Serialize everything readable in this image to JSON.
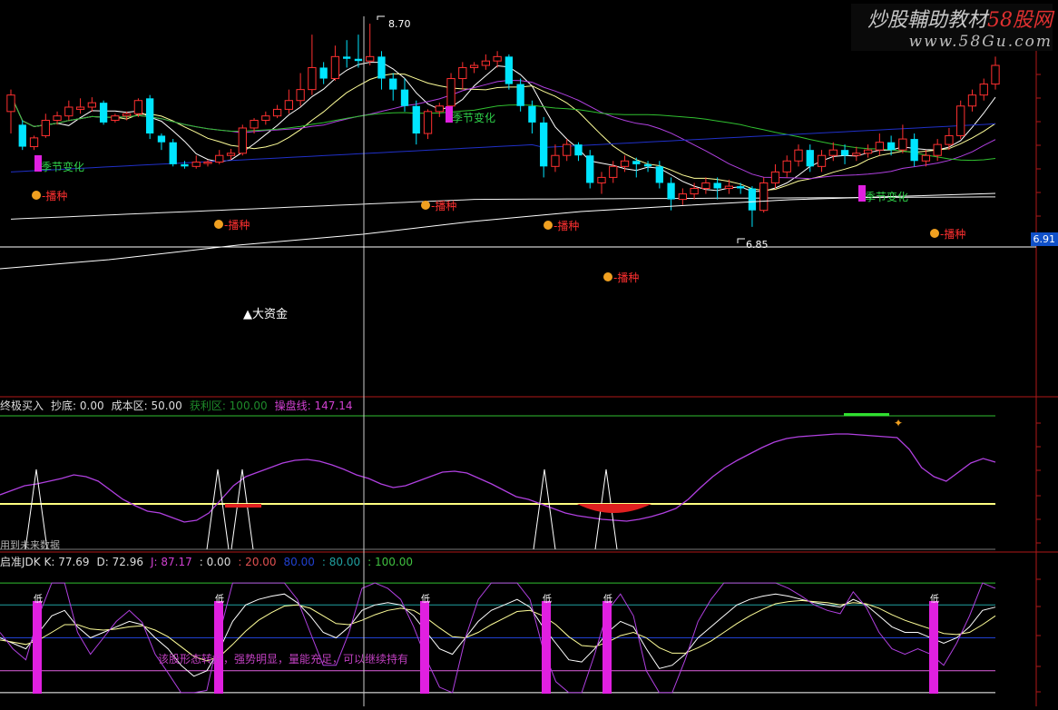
{
  "watermark": {
    "line1_a": "炒股輔助教材",
    "line1_b": "58股网",
    "line2": "www.58Gu.com"
  },
  "price_axis": {
    "current": "6.91"
  },
  "main_panel": {
    "high_label": "8.70",
    "low_label": "6.85",
    "big_fund_label": "▲大资金",
    "annotations": [
      {
        "text": "季节变化",
        "type": "season"
      },
      {
        "text": "季节变化",
        "type": "season"
      },
      {
        "text": "季节变化",
        "type": "season"
      },
      {
        "text": "播种",
        "type": "sow"
      },
      {
        "text": "播种",
        "type": "sow"
      },
      {
        "text": "播种",
        "type": "sow"
      },
      {
        "text": "播种",
        "type": "sow"
      },
      {
        "text": "播种",
        "type": "sow"
      },
      {
        "text": "播种",
        "type": "sow"
      }
    ]
  },
  "mid_panel": {
    "items": [
      {
        "label": "终极买入",
        "color": "#dddddd"
      },
      {
        "label": "抄底: 0.00",
        "color": "#dddddd"
      },
      {
        "label": "成本区: 50.00",
        "color": "#dddddd"
      },
      {
        "label": "获利区: 100.00",
        "color": "#1e8a2a"
      },
      {
        "label": "操盘线: 147.14",
        "color": "#d040d0"
      }
    ],
    "footer_text": "用到未来数据"
  },
  "lower_panel": {
    "items": [
      {
        "label": "启准JDK K: 77.69",
        "color": "#dddddd"
      },
      {
        "label": "D: 72.96",
        "color": "#dddddd"
      },
      {
        "label": "J: 87.17",
        "color": "#d040d0"
      },
      {
        "label": ": 0.00",
        "color": "#dddddd"
      },
      {
        "label": ": 20.00",
        "color": "#e05050"
      },
      {
        "label": "80.00",
        "color": "#2040d0"
      },
      {
        "label": ": 80.00",
        "color": "#20a0a0"
      },
      {
        "label": ": 100.00",
        "color": "#40c040"
      }
    ],
    "comment": "该股形态转好，强势明显，量能充足，可以继续持有",
    "low_marker": "低"
  },
  "colors": {
    "up": "#ff3030",
    "down": "#00e5ff",
    "magenta": "#e020e0",
    "purple": "#b040e0",
    "green": "#30c030",
    "blue": "#2030c8",
    "white": "#ffffff",
    "yellow": "#ffff80"
  },
  "chart_data": [
    {
      "type": "candlestick",
      "title": "",
      "ylim": [
        6.7,
        8.75
      ],
      "candles": [
        [
          0,
          7.9,
          8.05,
          7.7,
          8.1
        ],
        [
          1,
          7.78,
          7.58,
          7.55,
          7.82
        ],
        [
          2,
          7.58,
          7.66,
          7.55,
          7.68
        ],
        [
          3,
          7.68,
          7.82,
          7.66,
          7.88
        ],
        [
          4,
          7.82,
          7.86,
          7.78,
          7.9
        ],
        [
          5,
          7.86,
          7.94,
          7.82,
          8.0
        ],
        [
          6,
          7.92,
          7.94,
          7.88,
          8.02
        ],
        [
          7,
          7.94,
          7.98,
          7.9,
          8.03
        ],
        [
          8,
          7.98,
          7.8,
          7.78,
          8.0
        ],
        [
          9,
          7.82,
          7.86,
          7.8,
          7.88
        ],
        [
          10,
          7.86,
          7.88,
          7.82,
          7.9
        ],
        [
          11,
          7.88,
          8.0,
          7.85,
          8.02
        ],
        [
          12,
          8.02,
          7.7,
          7.65,
          8.05
        ],
        [
          13,
          7.68,
          7.62,
          7.55,
          7.7
        ],
        [
          14,
          7.62,
          7.42,
          7.4,
          7.65
        ],
        [
          15,
          7.42,
          7.4,
          7.38,
          7.45
        ],
        [
          16,
          7.4,
          7.44,
          7.38,
          7.5
        ],
        [
          17,
          7.44,
          7.44,
          7.4,
          7.46
        ],
        [
          18,
          7.44,
          7.5,
          7.42,
          7.55
        ],
        [
          19,
          7.5,
          7.52,
          7.46,
          7.56
        ],
        [
          20,
          7.52,
          7.75,
          7.5,
          7.78
        ],
        [
          21,
          7.75,
          7.82,
          7.7,
          7.84
        ],
        [
          22,
          7.82,
          7.86,
          7.78,
          7.9
        ],
        [
          23,
          7.86,
          7.92,
          7.84,
          7.96
        ],
        [
          24,
          7.92,
          8.0,
          7.88,
          8.1
        ],
        [
          25,
          8.0,
          8.1,
          7.95,
          8.25
        ],
        [
          26,
          8.1,
          8.3,
          8.05,
          8.6
        ],
        [
          27,
          8.3,
          8.2,
          8.15,
          8.35
        ],
        [
          28,
          8.2,
          8.4,
          8.18,
          8.5
        ],
        [
          29,
          8.4,
          8.38,
          8.3,
          8.55
        ],
        [
          30,
          8.38,
          8.36,
          8.3,
          8.6
        ],
        [
          31,
          8.36,
          8.4,
          8.32,
          8.7
        ],
        [
          32,
          8.4,
          8.2,
          8.1,
          8.45
        ],
        [
          33,
          8.2,
          8.1,
          8.0,
          8.25
        ],
        [
          34,
          8.1,
          7.95,
          7.9,
          8.2
        ],
        [
          35,
          7.95,
          7.7,
          7.6,
          8.0
        ],
        [
          36,
          7.7,
          7.9,
          7.65,
          7.92
        ],
        [
          37,
          7.9,
          7.95,
          7.85,
          7.98
        ],
        [
          38,
          7.95,
          8.2,
          7.9,
          8.25
        ],
        [
          39,
          8.2,
          8.3,
          8.1,
          8.35
        ],
        [
          40,
          8.3,
          8.32,
          8.25,
          8.35
        ],
        [
          41,
          8.32,
          8.36,
          8.28,
          8.42
        ],
        [
          42,
          8.36,
          8.4,
          8.3,
          8.45
        ],
        [
          43,
          8.4,
          8.15,
          8.1,
          8.42
        ],
        [
          44,
          8.15,
          7.95,
          7.9,
          8.2
        ],
        [
          45,
          7.95,
          7.8,
          7.7,
          8.0
        ],
        [
          46,
          7.8,
          7.4,
          7.3,
          7.85
        ],
        [
          47,
          7.4,
          7.5,
          7.35,
          7.6
        ],
        [
          48,
          7.5,
          7.6,
          7.45,
          7.65
        ],
        [
          49,
          7.6,
          7.5,
          7.45,
          7.62
        ],
        [
          50,
          7.5,
          7.25,
          7.2,
          7.55
        ],
        [
          51,
          7.25,
          7.3,
          7.15,
          7.35
        ],
        [
          52,
          7.3,
          7.4,
          7.25,
          7.45
        ],
        [
          53,
          7.4,
          7.45,
          7.35,
          7.5
        ],
        [
          54,
          7.45,
          7.42,
          7.3,
          7.48
        ],
        [
          55,
          7.42,
          7.4,
          7.35,
          7.45
        ],
        [
          56,
          7.4,
          7.25,
          7.2,
          7.45
        ],
        [
          57,
          7.25,
          7.1,
          7.0,
          7.3
        ],
        [
          58,
          7.1,
          7.15,
          7.05,
          7.2
        ],
        [
          59,
          7.15,
          7.2,
          7.1,
          7.25
        ],
        [
          60,
          7.2,
          7.25,
          7.15,
          7.3
        ],
        [
          61,
          7.25,
          7.2,
          7.1,
          7.3
        ],
        [
          62,
          7.2,
          7.22,
          7.15,
          7.28
        ],
        [
          63,
          7.22,
          7.2,
          7.15,
          7.25
        ],
        [
          64,
          7.2,
          7.0,
          6.85,
          7.22
        ],
        [
          65,
          7.0,
          7.25,
          6.98,
          7.3
        ],
        [
          66,
          7.25,
          7.35,
          7.2,
          7.42
        ],
        [
          67,
          7.35,
          7.45,
          7.3,
          7.5
        ],
        [
          68,
          7.45,
          7.55,
          7.4,
          7.6
        ],
        [
          69,
          7.55,
          7.4,
          7.35,
          7.6
        ],
        [
          70,
          7.4,
          7.5,
          7.35,
          7.55
        ],
        [
          71,
          7.5,
          7.55,
          7.45,
          7.62
        ],
        [
          72,
          7.55,
          7.5,
          7.42,
          7.6
        ],
        [
          73,
          7.5,
          7.52,
          7.45,
          7.58
        ],
        [
          74,
          7.52,
          7.55,
          7.48,
          7.6
        ],
        [
          75,
          7.55,
          7.62,
          7.5,
          7.7
        ],
        [
          76,
          7.62,
          7.55,
          7.5,
          7.68
        ],
        [
          77,
          7.55,
          7.65,
          7.52,
          7.78
        ],
        [
          78,
          7.65,
          7.45,
          7.4,
          7.7
        ],
        [
          79,
          7.45,
          7.5,
          7.4,
          7.55
        ],
        [
          80,
          7.5,
          7.6,
          7.45,
          7.65
        ],
        [
          81,
          7.6,
          7.68,
          7.55,
          7.75
        ],
        [
          82,
          7.68,
          7.95,
          7.65,
          8.0
        ],
        [
          83,
          7.95,
          8.05,
          7.9,
          8.1
        ],
        [
          84,
          8.05,
          8.15,
          8.0,
          8.2
        ],
        [
          85,
          8.15,
          8.32,
          8.1,
          8.4
        ]
      ]
    },
    {
      "type": "line",
      "title": "",
      "series": [
        {
          "values": [
            60,
            65,
            70,
            72,
            75,
            78,
            82,
            80,
            75,
            65,
            55,
            48,
            42,
            40,
            35,
            30,
            32,
            40,
            55,
            70,
            80,
            85,
            90,
            95,
            98,
            99,
            97,
            93,
            88,
            82,
            78,
            72,
            68,
            70,
            75,
            80,
            85,
            86,
            84,
            78,
            72,
            65,
            58,
            55,
            50,
            45,
            40,
            37,
            35,
            33,
            32,
            31,
            33,
            36,
            40,
            45,
            55,
            68,
            80,
            90,
            98,
            105,
            112,
            118,
            122,
            124,
            125,
            126,
            127,
            127,
            126,
            125,
            124,
            123,
            110,
            90,
            80,
            75,
            85,
            95,
            100,
            96
          ]
        }
      ],
      "ylim": [
        0,
        150
      ]
    },
    {
      "type": "line",
      "title": "",
      "series": [
        {
          "name": "K",
          "values": [
            50,
            45,
            40,
            55,
            70,
            75,
            60,
            50,
            55,
            60,
            65,
            62,
            50,
            40,
            25,
            15,
            20,
            40,
            65,
            80,
            85,
            88,
            90,
            82,
            70,
            55,
            50,
            60,
            75,
            80,
            82,
            80,
            70,
            55,
            40,
            35,
            50,
            65,
            75,
            80,
            85,
            78,
            60,
            45,
            30,
            28,
            40,
            55,
            65,
            60,
            40,
            22,
            25,
            35,
            50,
            60,
            70,
            80,
            85,
            88,
            90,
            88,
            85,
            82,
            80,
            78,
            85,
            80,
            70,
            60,
            55,
            55,
            50,
            45,
            50,
            60,
            75,
            78
          ]
        },
        {
          "name": "D",
          "values": [
            48,
            46,
            44,
            48,
            55,
            62,
            62,
            58,
            57,
            58,
            60,
            61,
            57,
            51,
            42,
            33,
            29,
            33,
            44,
            56,
            66,
            73,
            79,
            80,
            77,
            70,
            63,
            62,
            66,
            71,
            75,
            77,
            75,
            68,
            59,
            51,
            50,
            55,
            62,
            68,
            74,
            75,
            70,
            62,
            51,
            43,
            42,
            46,
            52,
            55,
            50,
            41,
            36,
            36,
            41,
            47,
            55,
            63,
            70,
            76,
            81,
            83,
            84,
            83,
            82,
            80,
            82,
            81,
            77,
            71,
            66,
            62,
            58,
            54,
            53,
            55,
            62,
            70
          ]
        },
        {
          "name": "J",
          "values": [
            55,
            40,
            30,
            70,
            100,
            100,
            55,
            35,
            50,
            65,
            75,
            64,
            35,
            18,
            0,
            0,
            2,
            55,
            100,
            100,
            100,
            100,
            100,
            85,
            55,
            25,
            25,
            55,
            95,
            100,
            95,
            85,
            60,
            30,
            5,
            0,
            50,
            85,
            100,
            100,
            100,
            85,
            40,
            10,
            0,
            0,
            35,
            75,
            90,
            70,
            20,
            0,
            0,
            30,
            65,
            85,
            100,
            100,
            100,
            100,
            100,
            95,
            88,
            80,
            75,
            72,
            92,
            78,
            55,
            40,
            35,
            40,
            35,
            25,
            45,
            70,
            100,
            95
          ]
        }
      ],
      "ylim": [
        -10,
        110
      ]
    }
  ]
}
